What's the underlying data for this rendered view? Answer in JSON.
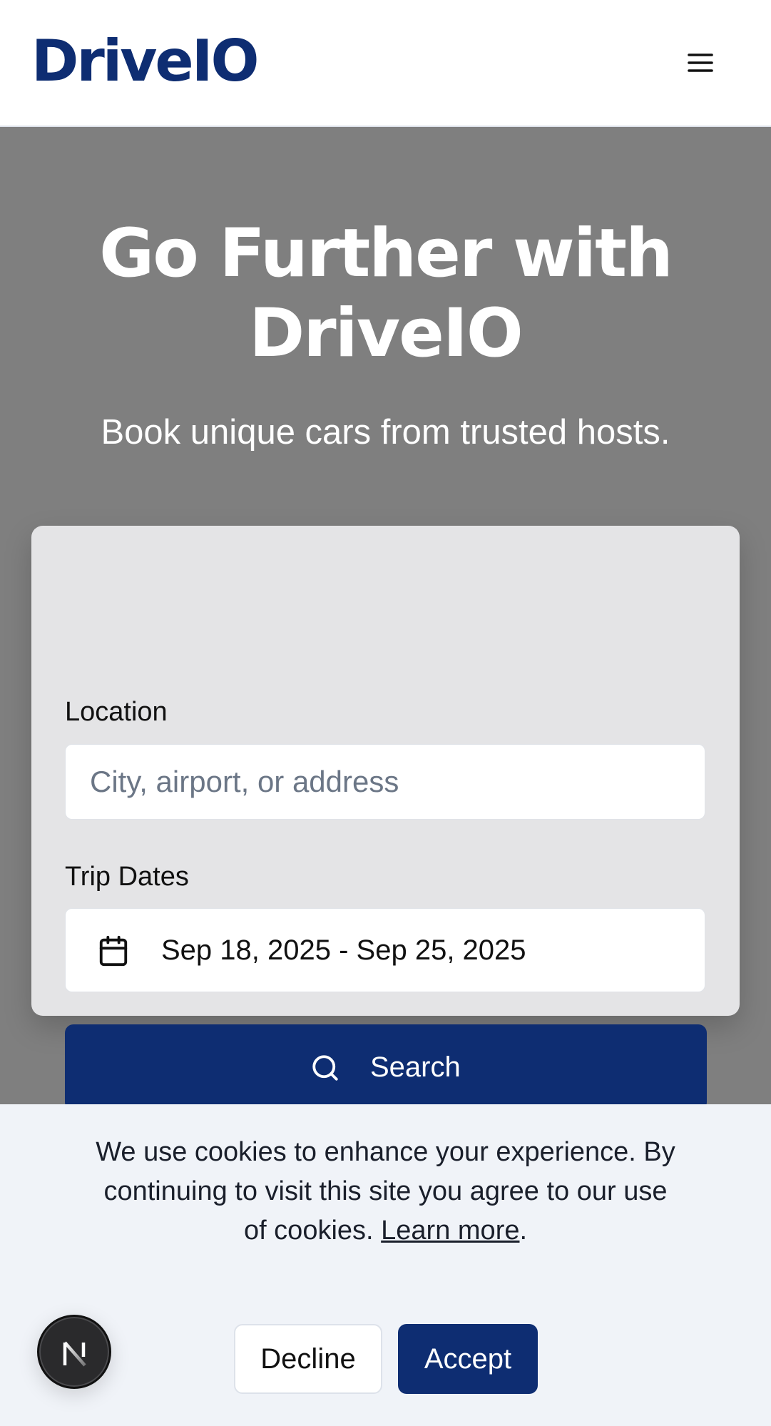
{
  "header": {
    "logo_text": "DriveIO",
    "menu_icon": "hamburger-menu-icon"
  },
  "hero": {
    "title": "Go Further with DriveIO",
    "subtitle": "Book unique cars from trusted hosts."
  },
  "search": {
    "location_label": "Location",
    "location_placeholder": "City, airport, or address",
    "location_value": "",
    "dates_label": "Trip Dates",
    "dates_value": "Sep 18, 2025 - Sep 25, 2025",
    "calendar_icon": "calendar-icon",
    "search_icon": "search-icon",
    "search_button_label": "Search"
  },
  "cookie_banner": {
    "text": "We use cookies to enhance your experience. By continuing to visit this site you agree to our use of cookies.",
    "link_label": "Learn more",
    "link_suffix": ".",
    "decline_label": "Decline",
    "accept_label": "Accept"
  },
  "badge": {
    "icon": "next-n-icon"
  },
  "colors": {
    "brand": "#0e2d72",
    "hero_background": "#7f7f7f",
    "card_background": "#e4e4e6",
    "banner_background": "#f0f3f8"
  }
}
